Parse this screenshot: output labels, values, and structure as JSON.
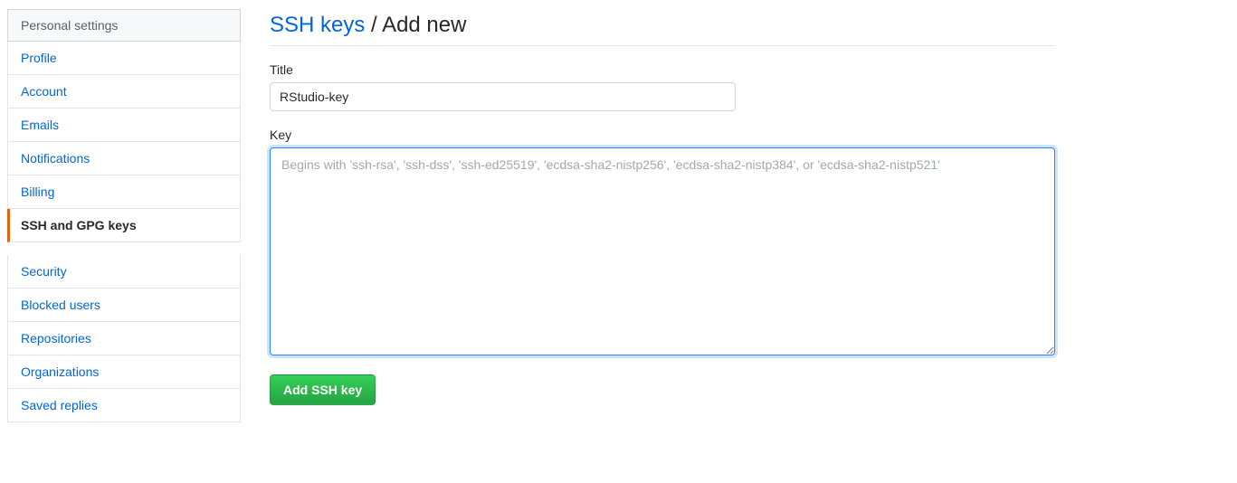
{
  "sidebar": {
    "header": "Personal settings",
    "items": [
      {
        "label": "Profile",
        "active": false
      },
      {
        "label": "Account",
        "active": false
      },
      {
        "label": "Emails",
        "active": false
      },
      {
        "label": "Notifications",
        "active": false
      },
      {
        "label": "Billing",
        "active": false
      },
      {
        "label": "SSH and GPG keys",
        "active": true
      },
      {
        "label": "Security",
        "active": false,
        "gapBefore": true
      },
      {
        "label": "Blocked users",
        "active": false
      },
      {
        "label": "Repositories",
        "active": false
      },
      {
        "label": "Organizations",
        "active": false
      },
      {
        "label": "Saved replies",
        "active": false
      }
    ]
  },
  "heading": {
    "link": "SSH keys",
    "separator": " / ",
    "sub": "Add new"
  },
  "form": {
    "title_label": "Title",
    "title_value": "RStudio-key",
    "key_label": "Key",
    "key_value": "",
    "key_placeholder": "Begins with 'ssh-rsa', 'ssh-dss', 'ssh-ed25519', 'ecdsa-sha2-nistp256', 'ecdsa-sha2-nistp384', or 'ecdsa-sha2-nistp521'",
    "submit_label": "Add SSH key"
  }
}
